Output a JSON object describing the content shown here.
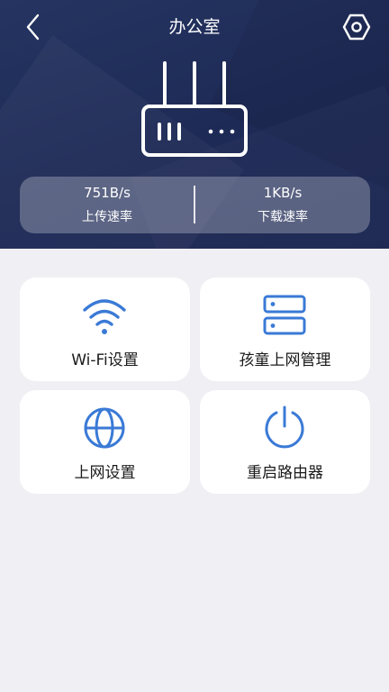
{
  "header": {
    "title": "办公室",
    "back_icon": "chevron-left-icon",
    "settings_icon": "hexagon-settings-icon",
    "device_icon": "router-icon"
  },
  "speed": {
    "upload": {
      "value": "751B/s",
      "label": "上传速率"
    },
    "download": {
      "value": "1KB/s",
      "label": "下载速率"
    }
  },
  "features": [
    {
      "label": "Wi-Fi设置",
      "icon": "wifi-icon"
    },
    {
      "label": "孩童上网管理",
      "icon": "server-icon"
    },
    {
      "label": "上网设置",
      "icon": "globe-icon"
    },
    {
      "label": "重启路由器",
      "icon": "power-icon"
    }
  ],
  "colors": {
    "header_bg": "#1e2a56",
    "accent_icon": "#3a7ad6",
    "page_bg": "#f0eff4",
    "card_bg": "#ffffff"
  }
}
